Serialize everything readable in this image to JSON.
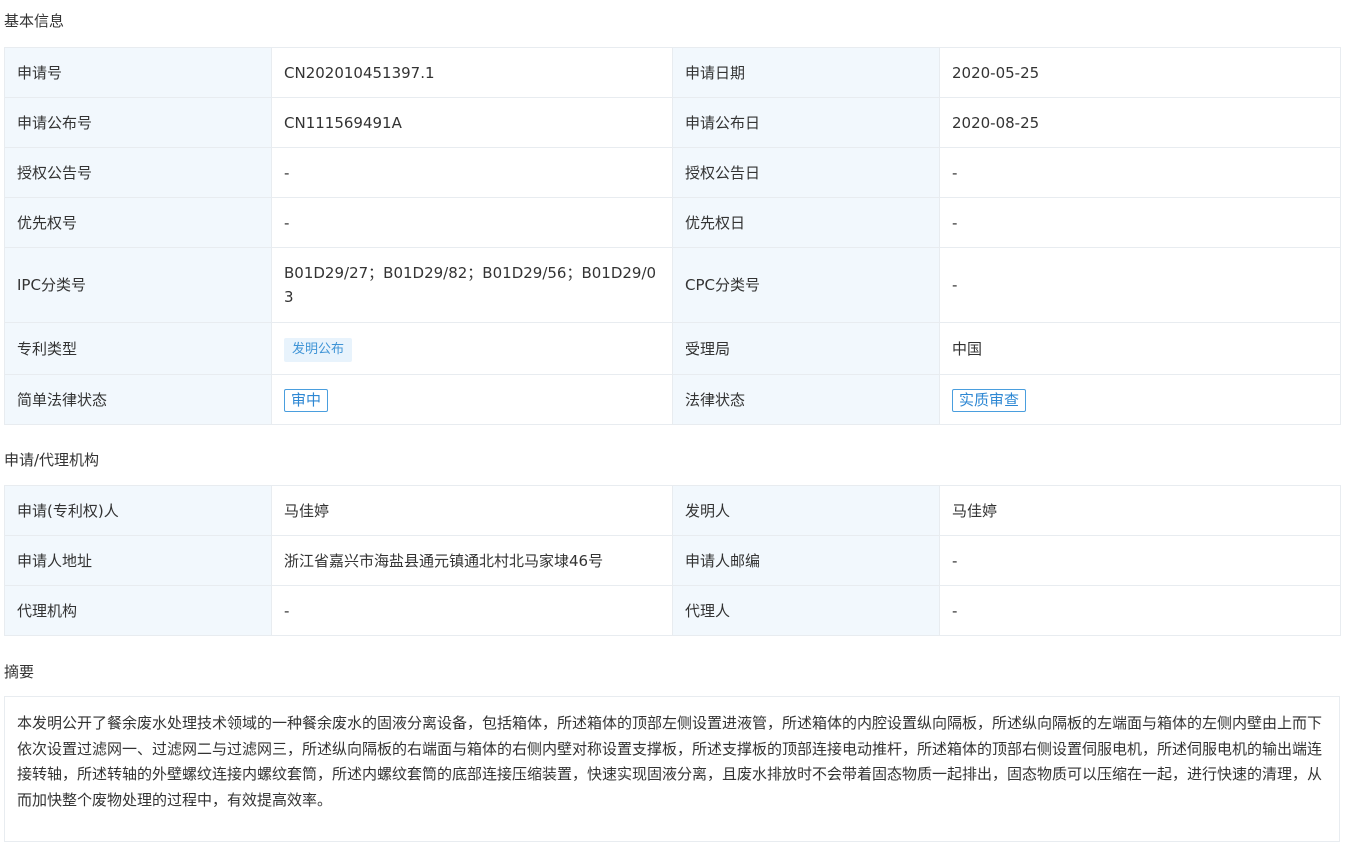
{
  "sections": {
    "basic": "基本信息",
    "agency": "申请/代理机构",
    "abstract": "摘要"
  },
  "basic": {
    "app_no_label": "申请号",
    "app_no": "CN202010451397.1",
    "app_date_label": "申请日期",
    "app_date": "2020-05-25",
    "pub_no_label": "申请公布号",
    "pub_no": "CN111569491A",
    "pub_date_label": "申请公布日",
    "pub_date": "2020-08-25",
    "grant_no_label": "授权公告号",
    "grant_no": "-",
    "grant_date_label": "授权公告日",
    "grant_date": "-",
    "priority_no_label": "优先权号",
    "priority_no": "-",
    "priority_date_label": "优先权日",
    "priority_date": "-",
    "ipc_label": "IPC分类号",
    "ipc": "B01D29/27；B01D29/82；B01D29/56；B01D29/03",
    "cpc_label": "CPC分类号",
    "cpc": "-",
    "patent_type_label": "专利类型",
    "patent_type": "发明公布",
    "office_label": "受理局",
    "office": "中国",
    "simple_status_label": "简单法律状态",
    "simple_status": "审中",
    "legal_status_label": "法律状态",
    "legal_status": "实质审查"
  },
  "agency": {
    "applicant_label": "申请(专利权)人",
    "applicant": "马佳婷",
    "inventor_label": "发明人",
    "inventor": "马佳婷",
    "address_label": "申请人地址",
    "address": "浙江省嘉兴市海盐县通元镇通北村北马家埭46号",
    "postcode_label": "申请人邮编",
    "postcode": "-",
    "agency_label": "代理机构",
    "agency_name": "-",
    "agent_label": "代理人",
    "agent": "-"
  },
  "abstract_text": "本发明公开了餐余废水处理技术领域的一种餐余废水的固液分离设备，包括箱体，所述箱体的顶部左侧设置进液管，所述箱体的内腔设置纵向隔板，所述纵向隔板的左端面与箱体的左侧内壁由上而下依次设置过滤网一、过滤网二与过滤网三，所述纵向隔板的右端面与箱体的右侧内壁对称设置支撑板，所述支撑板的顶部连接电动推杆，所述箱体的顶部右侧设置伺服电机，所述伺服电机的输出端连接转轴，所述转轴的外壁螺纹连接内螺纹套筒，所述内螺纹套筒的底部连接压缩装置，快速实现固液分离，且废水排放时不会带着固态物质一起排出，固态物质可以压缩在一起，进行快速的清理，从而加快整个废物处理的过程中，有效提高效率。",
  "colors": {
    "label_bg": "#f2f8fd",
    "border": "#e8ecf0",
    "tag_blue": "#3f94d6"
  }
}
